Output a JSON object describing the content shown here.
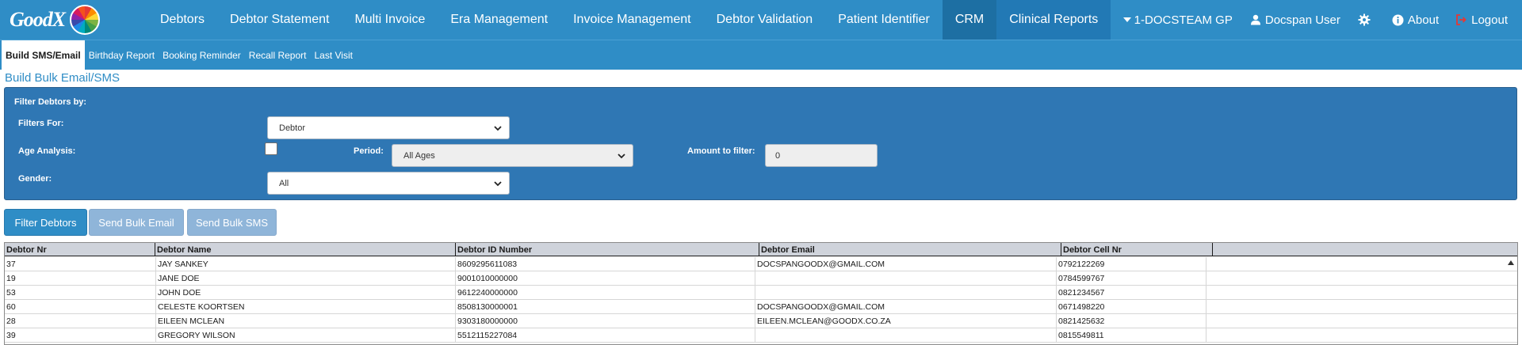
{
  "brand": {
    "logo_text": "GoodX"
  },
  "nav": {
    "items": [
      {
        "label": "Debtors"
      },
      {
        "label": "Debtor Statement"
      },
      {
        "label": "Multi Invoice"
      },
      {
        "label": "Era Management"
      },
      {
        "label": "Invoice Management"
      },
      {
        "label": "Debtor Validation"
      },
      {
        "label": "Patient Identifier"
      },
      {
        "label": "CRM",
        "active": true
      },
      {
        "label": "Clinical Reports"
      }
    ],
    "practice": "1-DOCSTEAM GP",
    "user": "Docspan User",
    "about": "About",
    "logout": "Logout"
  },
  "subnav": {
    "items": [
      {
        "label": "Build SMS/Email",
        "active": true
      },
      {
        "label": "Birthday Report"
      },
      {
        "label": "Booking Reminder"
      },
      {
        "label": "Recall Report"
      },
      {
        "label": "Last Visit"
      }
    ]
  },
  "page": {
    "title": "Build Bulk Email/SMS"
  },
  "filters": {
    "heading": "Filter Debtors by:",
    "filters_for_label": "Filters For:",
    "filters_for_value": "Debtor",
    "age_analysis_label": "Age Analysis:",
    "age_analysis_checked": false,
    "period_label": "Period:",
    "period_value": "All Ages",
    "amount_label": "Amount to filter:",
    "amount_value": "0",
    "gender_label": "Gender:",
    "gender_value": "All"
  },
  "buttons": {
    "filter": "Filter Debtors",
    "email": "Send Bulk Email",
    "sms": "Send Bulk SMS"
  },
  "table": {
    "columns": [
      "Debtor Nr",
      "Debtor Name",
      "Debtor ID Number",
      "Debtor Email",
      "Debtor Cell Nr",
      ""
    ],
    "rows": [
      [
        "37",
        "JAY SANKEY",
        "8609295611083",
        "DOCSPANGOODX@GMAIL.COM",
        "0792122269",
        ""
      ],
      [
        "19",
        "JANE DOE",
        "9001010000000",
        "",
        "0784599767",
        ""
      ],
      [
        "53",
        "JOHN DOE",
        "9612240000000",
        "",
        "0821234567",
        ""
      ],
      [
        "60",
        "CELESTE KOORTSEN",
        "8508130000001",
        "DOCSPANGOODX@GMAIL.COM",
        "0671498220",
        ""
      ],
      [
        "28",
        "EILEEN MCLEAN",
        "9303180000000",
        "EILEEN.MCLEAN@GOODX.CO.ZA",
        "0821425632",
        ""
      ],
      [
        "39",
        "GREGORY WILSON",
        "5512115227084",
        "",
        "0815549811",
        ""
      ]
    ]
  }
}
